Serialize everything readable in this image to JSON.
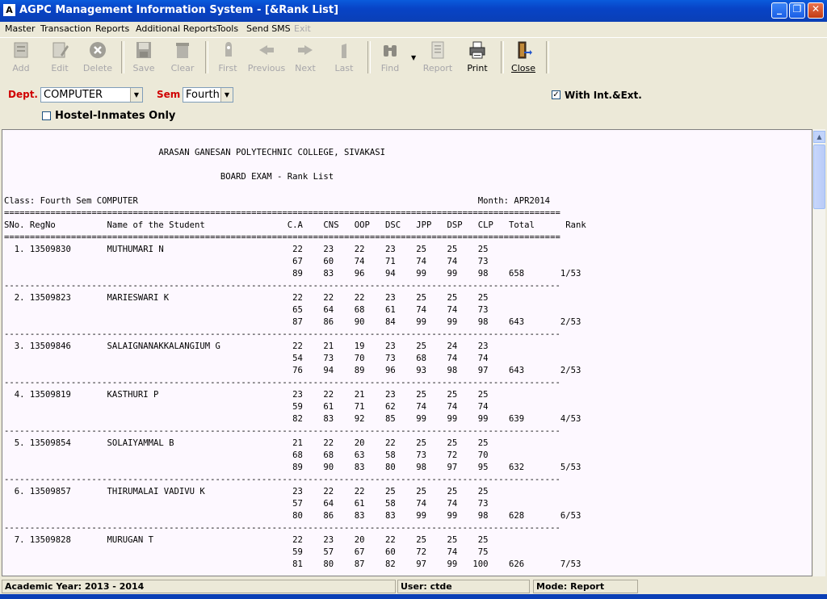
{
  "window": {
    "title": "AGPC Management Information System - [&Rank List]",
    "icon_name": "app-icon"
  },
  "menu": [
    {
      "label": "Master",
      "enabled": true
    },
    {
      "label": "Transaction",
      "enabled": true
    },
    {
      "label": "Reports",
      "enabled": true
    },
    {
      "label": "Additional Reports",
      "enabled": true
    },
    {
      "label": "Tools",
      "enabled": true
    },
    {
      "label": "Send SMS",
      "enabled": true
    },
    {
      "label": "Exit",
      "enabled": false
    }
  ],
  "toolbar": [
    {
      "label": "Add",
      "icon": "add-icon",
      "enabled": false
    },
    {
      "label": "Edit",
      "icon": "edit-icon",
      "enabled": false
    },
    {
      "label": "Delete",
      "icon": "delete-icon",
      "enabled": false
    },
    {
      "label": "Save",
      "icon": "save-icon",
      "enabled": false
    },
    {
      "label": "Clear",
      "icon": "clear-icon",
      "enabled": false
    },
    {
      "label": "First",
      "icon": "first-icon",
      "enabled": false
    },
    {
      "label": "Previous",
      "icon": "previous-icon",
      "enabled": false
    },
    {
      "label": "Next",
      "icon": "next-icon",
      "enabled": false
    },
    {
      "label": "Last",
      "icon": "last-icon",
      "enabled": false
    },
    {
      "label": "Find",
      "icon": "binoculars-icon",
      "enabled": false
    },
    {
      "label": "Report",
      "icon": "report-icon",
      "enabled": false
    },
    {
      "label": "Print",
      "icon": "printer-icon",
      "enabled": true
    },
    {
      "label": "Close",
      "icon": "exit-door-icon",
      "enabled": true
    }
  ],
  "filters": {
    "dept_label": "Dept.",
    "dept_value": "COMPUTER",
    "sem_label": "Sem",
    "sem_value": "Fourth",
    "with_int_ext_label": "With Int.&Ext.",
    "with_int_ext_checked": true,
    "hostel_label": "Hostel-Inmates Only",
    "hostel_checked": false
  },
  "report": {
    "college": "ARASAN GANESAN POLYTECHNIC COLLEGE, SIVAKASI",
    "exam_title": "BOARD EXAM - Rank List",
    "class_text": "Class: Fourth Sem COMPUTER",
    "month_text": "Month: APR2014",
    "columns": [
      "SNo.",
      "RegNo",
      "Name of the Student",
      "C.A",
      "CNS",
      "OOP",
      "DSC",
      "JPP",
      "DSP",
      "CLP",
      "Total",
      "Rank"
    ],
    "students": [
      {
        "sno": "1.",
        "regno": "13509830",
        "name": "MUTHUMARI N",
        "internal": [
          "22",
          "23",
          "22",
          "23",
          "25",
          "25",
          "25"
        ],
        "external": [
          "67",
          "60",
          "74",
          "71",
          "74",
          "74",
          "73"
        ],
        "total_marks": [
          "89",
          "83",
          "96",
          "94",
          "99",
          "99",
          "98"
        ],
        "total": "658",
        "rank": "1/53"
      },
      {
        "sno": "2.",
        "regno": "13509823",
        "name": "MARIESWARI K",
        "internal": [
          "22",
          "22",
          "22",
          "23",
          "25",
          "25",
          "25"
        ],
        "external": [
          "65",
          "64",
          "68",
          "61",
          "74",
          "74",
          "73"
        ],
        "total_marks": [
          "87",
          "86",
          "90",
          "84",
          "99",
          "99",
          "98"
        ],
        "total": "643",
        "rank": "2/53"
      },
      {
        "sno": "3.",
        "regno": "13509846",
        "name": "SALAIGNANAKKALANGIUM G",
        "internal": [
          "22",
          "21",
          "19",
          "23",
          "25",
          "24",
          "23"
        ],
        "external": [
          "54",
          "73",
          "70",
          "73",
          "68",
          "74",
          "74"
        ],
        "total_marks": [
          "76",
          "94",
          "89",
          "96",
          "93",
          "98",
          "97"
        ],
        "total": "643",
        "rank": "2/53"
      },
      {
        "sno": "4.",
        "regno": "13509819",
        "name": "KASTHURI P",
        "internal": [
          "23",
          "22",
          "21",
          "23",
          "25",
          "25",
          "25"
        ],
        "external": [
          "59",
          "61",
          "71",
          "62",
          "74",
          "74",
          "74"
        ],
        "total_marks": [
          "82",
          "83",
          "92",
          "85",
          "99",
          "99",
          "99"
        ],
        "total": "639",
        "rank": "4/53"
      },
      {
        "sno": "5.",
        "regno": "13509854",
        "name": "SOLAIYAMMAL B",
        "internal": [
          "21",
          "22",
          "20",
          "22",
          "25",
          "25",
          "25"
        ],
        "external": [
          "68",
          "68",
          "63",
          "58",
          "73",
          "72",
          "70"
        ],
        "total_marks": [
          "89",
          "90",
          "83",
          "80",
          "98",
          "97",
          "95"
        ],
        "total": "632",
        "rank": "5/53"
      },
      {
        "sno": "6.",
        "regno": "13509857",
        "name": "THIRUMALAI VADIVU K",
        "internal": [
          "23",
          "22",
          "22",
          "25",
          "25",
          "25",
          "25"
        ],
        "external": [
          "57",
          "64",
          "61",
          "58",
          "74",
          "74",
          "73"
        ],
        "total_marks": [
          "80",
          "86",
          "83",
          "83",
          "99",
          "99",
          "98"
        ],
        "total": "628",
        "rank": "6/53"
      },
      {
        "sno": "7.",
        "regno": "13509828",
        "name": "MURUGAN T",
        "internal": [
          "22",
          "23",
          "20",
          "22",
          "25",
          "25",
          "25"
        ],
        "external": [
          "59",
          "57",
          "67",
          "60",
          "72",
          "74",
          "75"
        ],
        "total_marks": [
          "81",
          "80",
          "87",
          "82",
          "97",
          "99",
          "100"
        ],
        "total": "626",
        "rank": "7/53"
      }
    ]
  },
  "status": {
    "academic_year": "Academic Year: 2013 - 2014",
    "user": "User: ctde",
    "mode": "Mode: Report"
  }
}
